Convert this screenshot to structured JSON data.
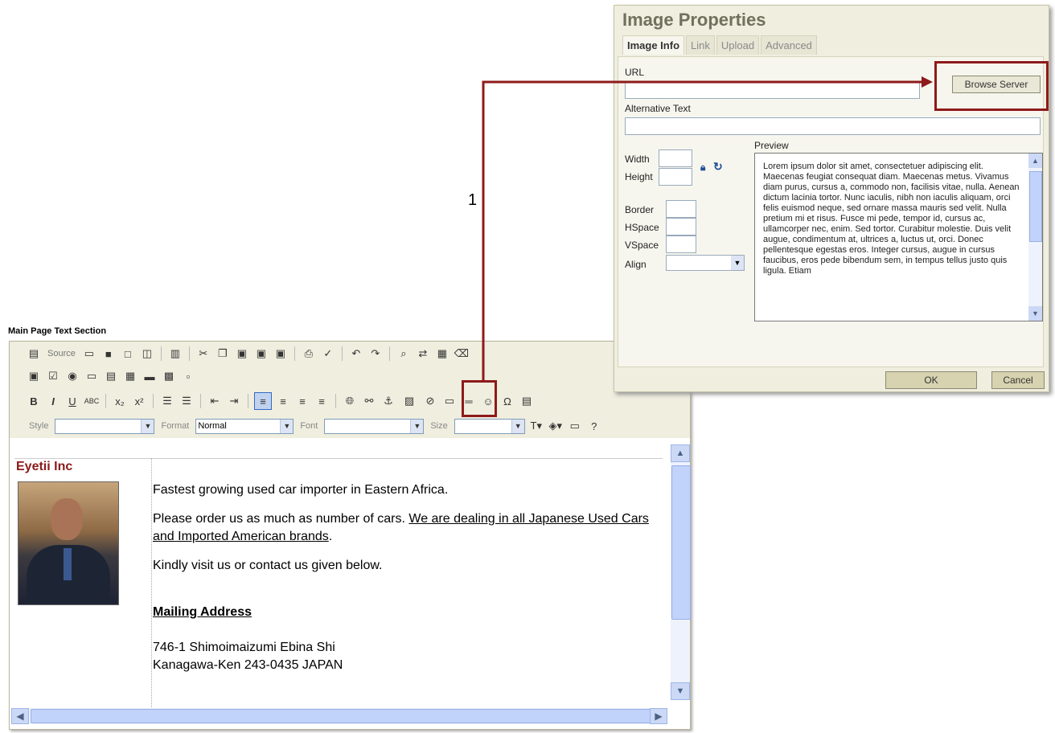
{
  "editor": {
    "section_title": "Main Page Text Section",
    "toolbar": {
      "source_label": "Source",
      "style_label": "Style",
      "format_label": "Format",
      "format_value": "Normal",
      "font_label": "Font",
      "size_label": "Size"
    },
    "content": {
      "company": "Eyetii Inc",
      "line1": "Fastest growing used car importer in Eastern Africa.",
      "line2_plain": "Please order us as much as number of cars. ",
      "line2_link": "We are dealing in all Japanese Used Cars and Imported American brands",
      "line2_end": ".",
      "line3": "Kindly visit us or contact us given below.",
      "mailing_heading": "Mailing Address",
      "address1": "746-1 Shimoimaizumi Ebina Shi",
      "address2": "Kanagawa-Ken 243-0435 JAPAN"
    }
  },
  "dialog": {
    "title": "Image Properties",
    "tabs": [
      "Image Info",
      "Link",
      "Upload",
      "Advanced"
    ],
    "url_label": "URL",
    "browse_button": "Browse Server",
    "alt_label": "Alternative Text",
    "width_label": "Width",
    "height_label": "Height",
    "border_label": "Border",
    "hspace_label": "HSpace",
    "vspace_label": "VSpace",
    "align_label": "Align",
    "preview_label": "Preview",
    "preview_text": "Lorem ipsum dolor sit amet, consectetuer adipiscing elit. Maecenas feugiat consequat diam. Maecenas metus. Vivamus diam purus, cursus a, commodo non, facilisis vitae, nulla. Aenean dictum lacinia tortor. Nunc iaculis, nibh non iaculis aliquam, orci felis euismod neque, sed ornare massa mauris sed velit. Nulla pretium mi et risus. Fusce mi pede, tempor id, cursus ac, ullamcorper nec, enim. Sed tortor. Curabitur molestie. Duis velit augue, condimentum at, ultrices a, luctus ut, orci. Donec pellentesque egestas eros. Integer cursus, augue in cursus faucibus, eros pede bibendum sem, in tempus tellus justo quis ligula. Etiam",
    "ok_button": "OK",
    "cancel_button": "Cancel"
  },
  "annotation": {
    "step_number": "1",
    "color": "#8e1a1a"
  }
}
